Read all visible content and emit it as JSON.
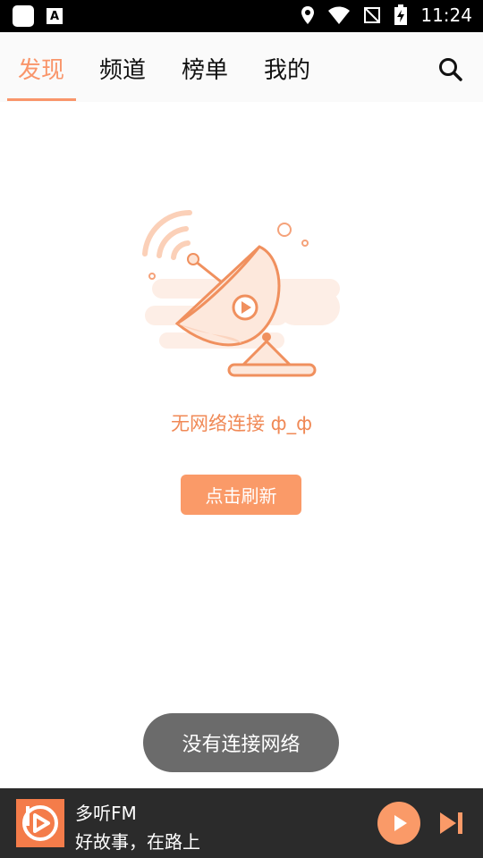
{
  "status_bar": {
    "time": "11:24"
  },
  "nav": {
    "tabs": [
      {
        "label": "发现",
        "active": true
      },
      {
        "label": "频道",
        "active": false
      },
      {
        "label": "榜单",
        "active": false
      },
      {
        "label": "我的",
        "active": false
      }
    ]
  },
  "empty_state": {
    "message": "无网络连接 ф_ф",
    "refresh_label": "点击刷新"
  },
  "toast": {
    "text": "没有连接网络"
  },
  "player": {
    "title": "多听FM",
    "subtitle": "好故事，在路上"
  },
  "colors": {
    "accent": "#f9956a",
    "player_bg": "#2b2b2b"
  }
}
